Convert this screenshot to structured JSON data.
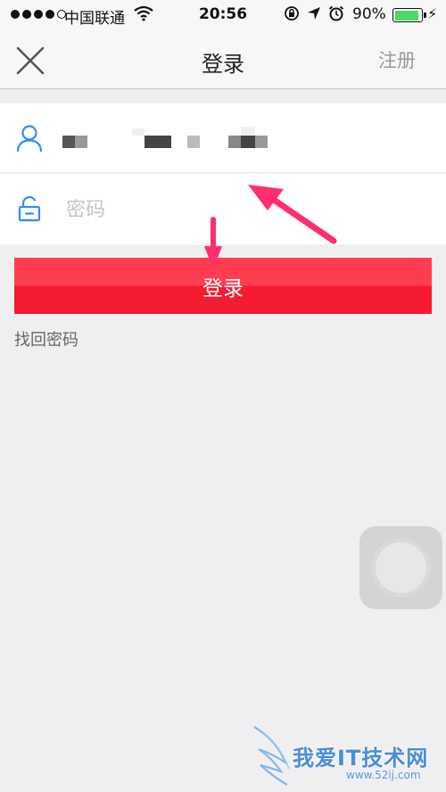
{
  "status_bar": {
    "carrier": "中国联通",
    "time": "20:56",
    "battery": "90%",
    "battery_level": 0.9,
    "battery_color": "#4cd964",
    "icons": [
      "wifi-icon",
      "rotation-lock-icon",
      "location-icon",
      "alarm-icon",
      "charging-icon"
    ]
  },
  "nav": {
    "title": "登录",
    "register_label": "注册",
    "close_icon": "close-icon"
  },
  "form": {
    "username_icon": "user-icon",
    "password_icon": "lock-icon",
    "password_placeholder": "密码"
  },
  "login_button": {
    "label": "登录",
    "color": "#ff2a3f"
  },
  "forgot_password": {
    "label": "找回密码"
  },
  "annotations": {
    "arrow_color": "#ff2f6e"
  },
  "watermark": {
    "text": "我爱IT技术网",
    "url": "www.52ij.com"
  }
}
